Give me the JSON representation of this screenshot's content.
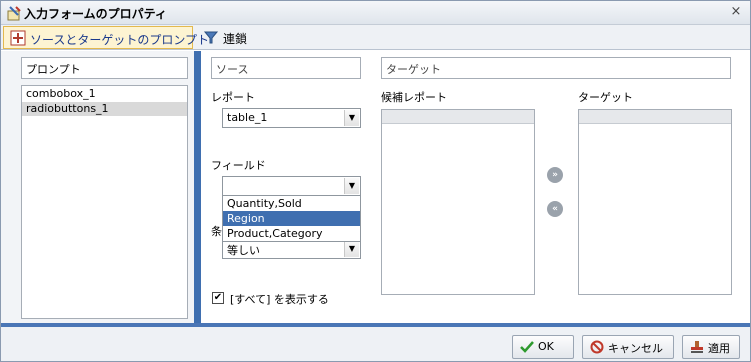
{
  "window": {
    "title": "入力フォームのプロパティ",
    "close_glyph": "×"
  },
  "tabs": [
    {
      "label": "ソースとターゲットのプロンプト",
      "icon": "prompt-icon",
      "active": true
    },
    {
      "label": "連鎖",
      "icon": "chain-icon",
      "active": false
    }
  ],
  "left": {
    "header": "プロンプト",
    "items": [
      "combobox_1",
      "radiobuttons_1"
    ],
    "selected_index": 1
  },
  "source": {
    "header": "ソース",
    "report_label": "レポート",
    "report_value": "table_1",
    "field_label": "フィールド",
    "field_value": "",
    "field_options": [
      "Quantity,Sold",
      "Region",
      "Product,Category"
    ],
    "field_highlighted": "Region",
    "condition_label_partial": "条",
    "condition_value": "等しい",
    "show_all_label": "[すべて] を表示する",
    "show_all_checked": true
  },
  "target": {
    "header": "ターゲット",
    "candidate_label": "候補レポート",
    "target_label": "ターゲット",
    "move_right_glyph": "»",
    "move_left_glyph": "«"
  },
  "buttons": {
    "ok": "OK",
    "cancel": "キャンセル",
    "apply": "適用"
  },
  "colors": {
    "accent": "#3f6fb0",
    "selection": "#d9d9d9",
    "tab_active_bg": "#fdf4d2"
  }
}
